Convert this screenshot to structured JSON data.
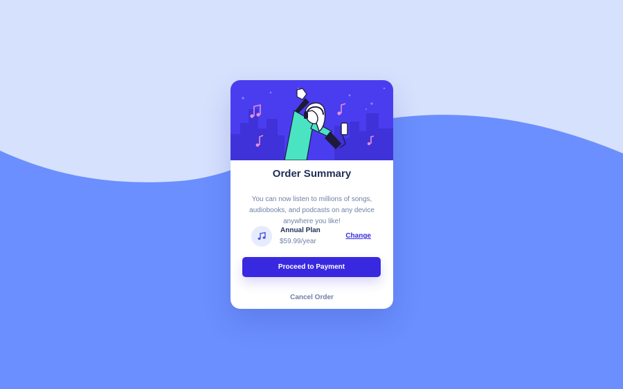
{
  "colors": {
    "background_light": "#d6e1fe",
    "background_wave": "#6b8ffe",
    "hero_bg": "#4a3df0",
    "primary": "#3829e0",
    "heading": "#1f2f56",
    "muted": "#6f7fa6"
  },
  "card": {
    "hero_illustration": "person-dancing-with-headphones-illustration",
    "title": "Order Summary",
    "description": "You can now listen to millions of songs, audiobooks, and podcasts on any device anywhere you like!",
    "plan": {
      "icon": "music-note-icon",
      "name": "Annual Plan",
      "price": "$59.99/year",
      "change_label": "Change"
    },
    "pay_button_label": "Proceed to Payment",
    "cancel_label": "Cancel Order"
  }
}
